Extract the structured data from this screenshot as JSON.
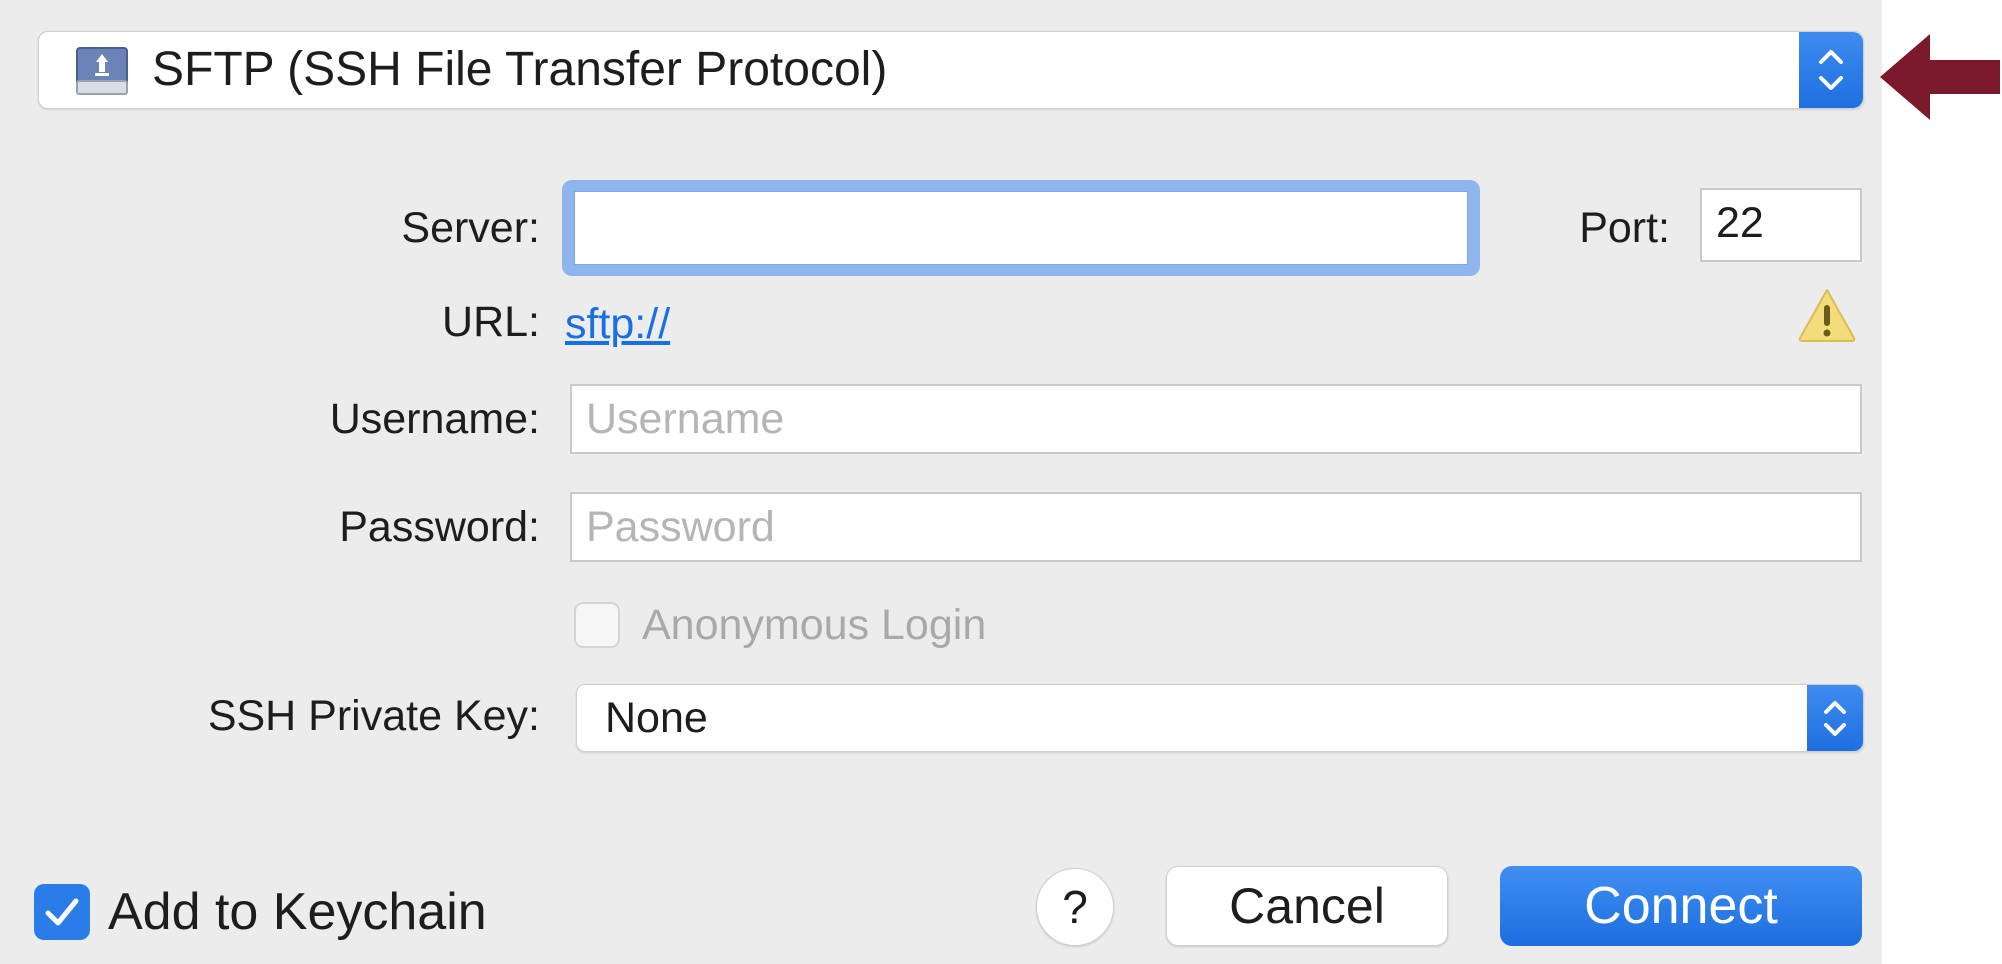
{
  "protocol": {
    "selected": "SFTP (SSH File Transfer Protocol)",
    "icon": "network-drive-icon"
  },
  "form": {
    "server_label": "Server:",
    "server_value": "",
    "port_label": "Port:",
    "port_value": "22",
    "url_label": "URL:",
    "url_value": "sftp://",
    "username_label": "Username:",
    "username_placeholder": "Username",
    "password_label": "Password:",
    "password_placeholder": "Password",
    "anonymous_label": "Anonymous Login",
    "anonymous_checked": false,
    "ssh_key_label": "SSH Private Key:",
    "ssh_key_value": "None"
  },
  "footer": {
    "keychain_label": "Add to Keychain",
    "keychain_checked": true,
    "help_label": "?",
    "cancel_label": "Cancel",
    "connect_label": "Connect"
  },
  "colors": {
    "accent": "#1f6fe0",
    "annotation_arrow": "#7a1a2a",
    "warning": "#f3dc7a",
    "dialog_bg": "#ececec"
  }
}
